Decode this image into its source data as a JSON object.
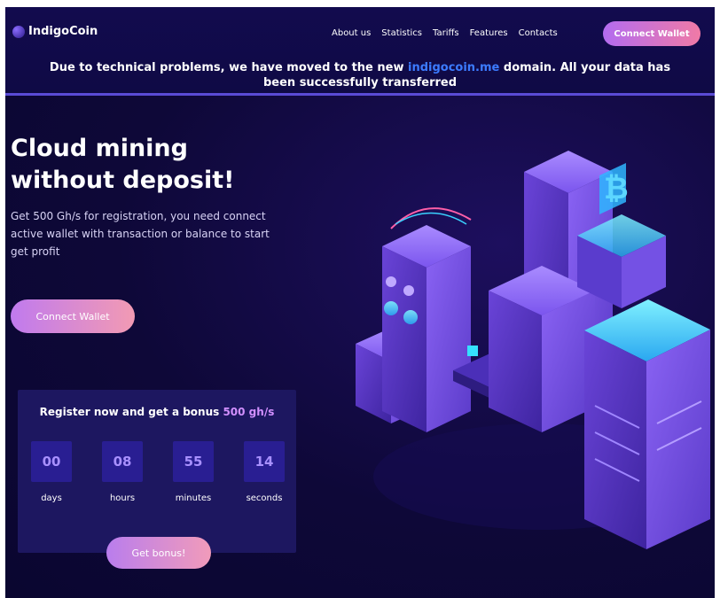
{
  "header": {
    "logo": "IndigoCoin",
    "nav": [
      "About us",
      "Statistics",
      "Tariffs",
      "Features",
      "Contacts"
    ],
    "connect_button": "Connect Wallet"
  },
  "notice": {
    "before": "Due to technical problems, we have moved to the new ",
    "domain": "indigocoin.me",
    "after": " domain. All your data has been successfully transferred"
  },
  "hero": {
    "title_line1": "Cloud mining",
    "title_line2": "without deposit!",
    "subtitle": "Get 500 Gh/s for registration, you need connect active wallet with transaction or balance to start get profit",
    "connect_button": "Connect Wallet"
  },
  "bonus": {
    "title": "Register now and get a bonus ",
    "amount": "500 gh/s",
    "countdown": [
      {
        "value": "00",
        "label": "days"
      },
      {
        "value": "08",
        "label": "hours"
      },
      {
        "value": "55",
        "label": "minutes"
      },
      {
        "value": "14",
        "label": "seconds"
      }
    ],
    "button": "Get bonus!"
  },
  "illustration": {
    "icon": "bitcoin-icon"
  },
  "colors": {
    "background": "#0e0838",
    "accent_gradient_start": "#b36cf0",
    "accent_gradient_end": "#f07aa6",
    "link": "#3c7bff",
    "tile": "#291e92"
  }
}
